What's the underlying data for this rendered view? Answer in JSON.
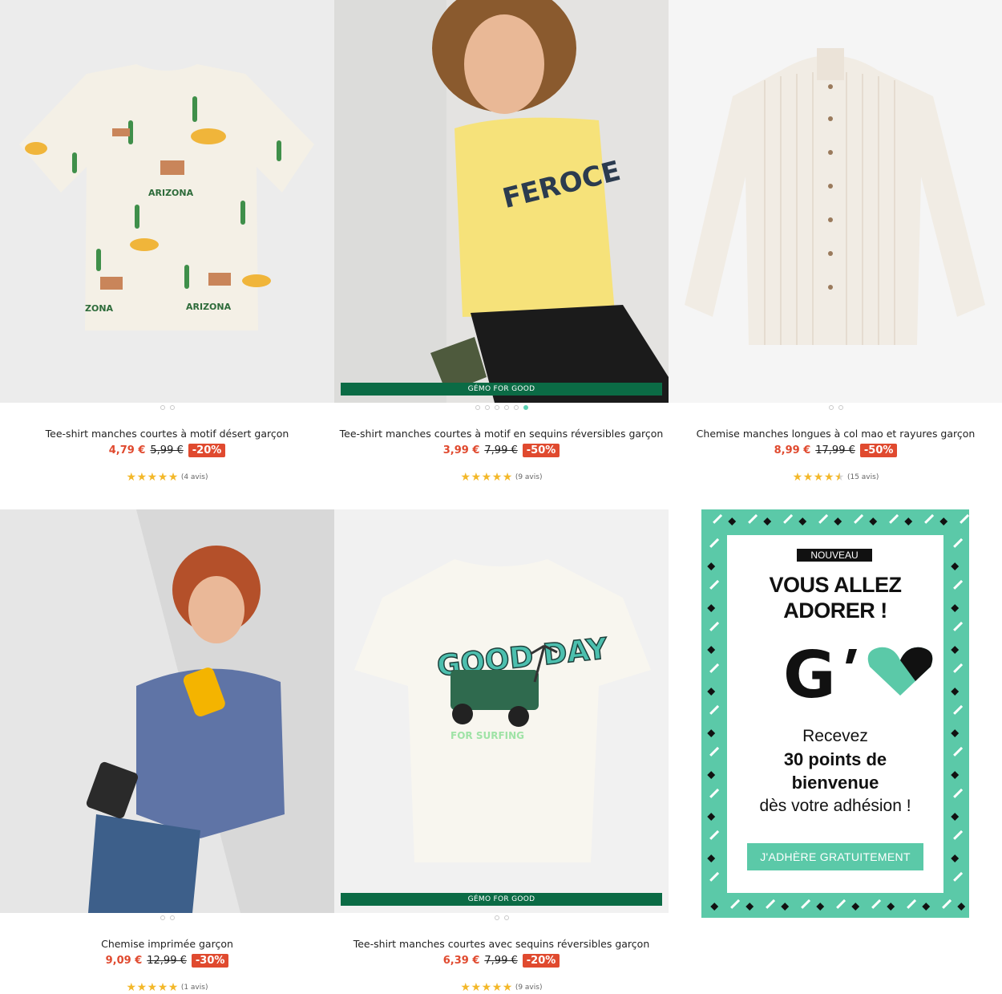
{
  "products": [
    {
      "name": "Tee-shirt manches courtes à motif désert garçon",
      "price": "4,79 €",
      "old_price": "5,99 €",
      "discount": "-20%",
      "stars": "★★★★★",
      "reviews": "(4 avis)",
      "image_dots": 2,
      "active_dot": -1,
      "badge": ""
    },
    {
      "name": "Tee-shirt manches courtes à motif en sequins réversibles garçon",
      "price": "3,99 €",
      "old_price": "7,99 €",
      "discount": "-50%",
      "stars": "★★★★★",
      "reviews": "(9 avis)",
      "image_dots": 6,
      "active_dot": 5,
      "badge": "GÉMO FOR GOOD"
    },
    {
      "name": "Chemise manches longues à col mao et rayures garçon",
      "price": "8,99 €",
      "old_price": "17,99 €",
      "discount": "-50%",
      "stars": "★★★★★",
      "reviews": "(15 avis)",
      "image_dots": 2,
      "active_dot": -1,
      "badge": ""
    },
    {
      "name": "Chemise imprimée garçon",
      "price": "9,09 €",
      "old_price": "12,99 €",
      "discount": "-30%",
      "stars": "★★★★★",
      "reviews": "(1 avis)",
      "image_dots": 2,
      "active_dot": -1,
      "badge": ""
    },
    {
      "name": "Tee-shirt manches courtes avec sequins réversibles garçon",
      "price": "6,39 €",
      "old_price": "7,99 €",
      "discount": "-20%",
      "stars": "★★★★★",
      "reviews": "(9 avis)",
      "image_dots": 2,
      "active_dot": -1,
      "badge": "GÉMO FOR GOOD"
    }
  ],
  "ratings_value": [
    5,
    5,
    4.5,
    5,
    5
  ],
  "promo": {
    "tag": "NOUVEAU",
    "headline_1": "VOUS ALLEZ",
    "headline_2": "ADORER !",
    "logo_letter": "G",
    "line_1": "Recevez",
    "line_2": "30 points de",
    "line_3": "bienvenue",
    "line_4": "dès votre adhésion !",
    "cta": "J'ADHÈRE GRATUITEMENT"
  },
  "colors": {
    "price_red": "#e04a2f",
    "badge_green": "#0b6b45",
    "promo_mint": "#5bc9a8",
    "star_yellow": "#f3b82a"
  },
  "icons": [
    "star-icon",
    "carousel-dot-icon",
    "heart-logo-icon"
  ]
}
